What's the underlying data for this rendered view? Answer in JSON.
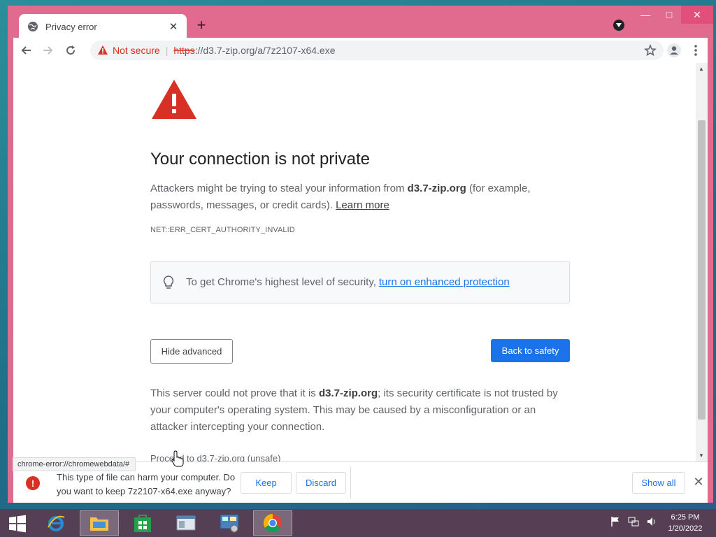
{
  "browser": {
    "tab": {
      "title": "Privacy error",
      "new_tab_label": "+"
    },
    "omnibox": {
      "security_label": "Not secure",
      "separator": "|",
      "scheme": "https",
      "rest": "://d3.7-zip.org/a/7z2107-x64.exe"
    }
  },
  "page": {
    "heading": "Your connection is not private",
    "desc_part1": "Attackers might be trying to steal your information from ",
    "desc_host": "d3.7-zip.org",
    "desc_part2": " (for example, passwords, messages, or credit cards). ",
    "learn_more": "Learn more",
    "error_code": "NET::ERR_CERT_AUTHORITY_INVALID",
    "callout_text": "To get Chrome's highest level of security,",
    "callout_link": "turn on enhanced protection",
    "hide_advanced": "Hide advanced",
    "back_to_safety": "Back to safety",
    "explain_part1": "This server could not prove that it is ",
    "explain_host": "d3.7-zip.org",
    "explain_part2": "; its security certificate is not trusted by your computer's operating system. This may be caused by a misconfiguration or an attacker intercepting your connection.",
    "proceed_link": "Proceed to d3.7-zip.org (unsafe)"
  },
  "status_tip": "chrome-error://chromewebdata/#",
  "download_bar": {
    "message": "This type of file can harm your computer. Do you want to keep 7z2107-x64.exe anyway?",
    "keep": "Keep",
    "discard": "Discard",
    "show_all": "Show all"
  },
  "taskbar": {
    "time": "6:25 PM",
    "date": "1/20/2022"
  },
  "colors": {
    "frame": "#e06b8f",
    "accent": "#1a73e8",
    "danger": "#d93025"
  }
}
